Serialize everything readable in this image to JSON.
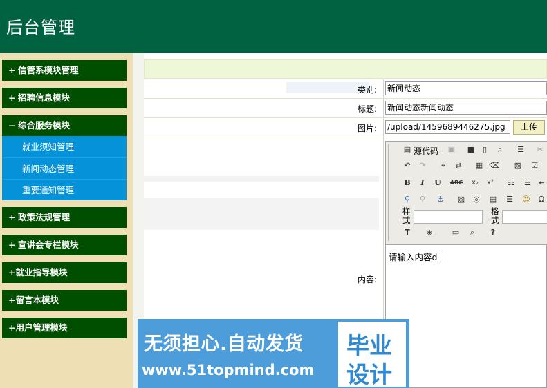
{
  "header": {
    "title": "后台管理"
  },
  "sidebar": {
    "menus": [
      {
        "sign": "+",
        "label": "信管系模块管理"
      },
      {
        "sign": "+",
        "label": "招聘信息模块"
      },
      {
        "sign": "−",
        "label": "综合服务模块",
        "items": [
          "就业须知管理",
          "新闻动态管理",
          "重要通知管理"
        ]
      },
      {
        "sign": "+",
        "label": "政策法规管理"
      },
      {
        "sign": "+",
        "label": "宣讲会专栏模块"
      },
      {
        "sign": "+",
        "label": "就业指导模块"
      },
      {
        "sign": "+",
        "label": "留言本模块"
      },
      {
        "sign": "+",
        "label": "用户管理模块"
      }
    ]
  },
  "form": {
    "category": {
      "label": "类别:",
      "value": "新闻动态"
    },
    "title": {
      "label": "标题:",
      "value": "新闻动态新闻动态"
    },
    "image": {
      "label": "图片:",
      "value": "/upload/1459689446275.jpg",
      "button": "上传"
    },
    "content": {
      "label": "内容:"
    }
  },
  "editor": {
    "source_label": "源代码",
    "style_label": "样式",
    "format_label": "格式",
    "content_text": "请输入内容d"
  },
  "watermark": {
    "line1": "无须担心.自动发货",
    "line2": "www.51topmind.com",
    "box1": "毕业",
    "box2": "设计"
  },
  "colors": {
    "header_bg": "#006241",
    "sidebar_bg": "#efdfb4",
    "menu_head_bg": "#004e00",
    "sub_item_bg": "#0592d8",
    "watermark_bg": "#4d9ddb"
  }
}
